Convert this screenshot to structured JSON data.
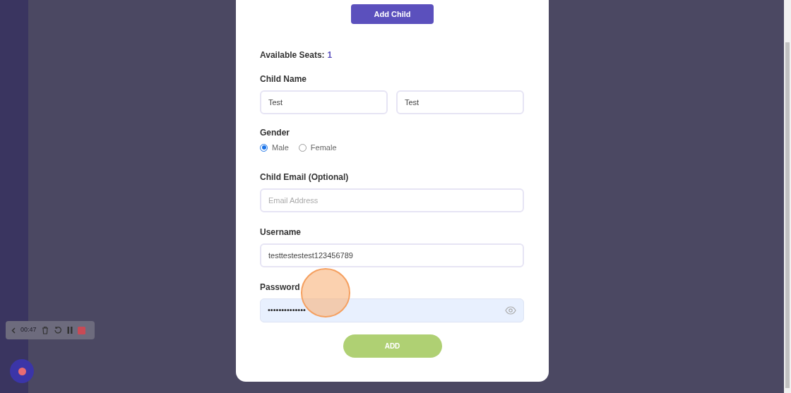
{
  "dialog": {
    "add_child_button": "Add Child",
    "available_seats": {
      "label": "Available Seats:",
      "value": "1"
    },
    "child_name": {
      "label": "Child Name",
      "fields": [
        {
          "value": "Test"
        },
        {
          "value": "Test"
        }
      ]
    },
    "gender": {
      "label": "Gender",
      "options": [
        {
          "label": "Male",
          "selected": true
        },
        {
          "label": "Female",
          "selected": false
        }
      ]
    },
    "child_email": {
      "label": "Child Email (Optional)",
      "placeholder": "Email Address"
    },
    "username": {
      "label": "Username",
      "value": "testtestestest123456789"
    },
    "password": {
      "label": "Password",
      "value": "••••••••••••••"
    },
    "submit_button": "ADD"
  },
  "recorder": {
    "timer": "00:47"
  }
}
